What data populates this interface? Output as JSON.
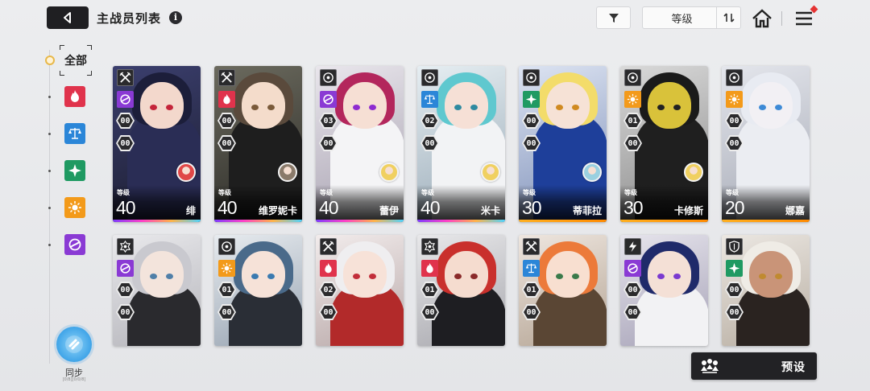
{
  "header": {
    "title": "主战员列表",
    "info_glyph": "i",
    "sort_label": "等级"
  },
  "sidebar": {
    "all_label": "全部",
    "elements": [
      {
        "name": "fire",
        "color": "#e0334c"
      },
      {
        "name": "order",
        "color": "#2b86d8"
      },
      {
        "name": "wind",
        "color": "#1f9a62"
      },
      {
        "name": "light",
        "color": "#f39a1a"
      },
      {
        "name": "void",
        "color": "#8a3ad4"
      }
    ],
    "sync_label": "同步",
    "sync_sub": "[0/8][0/0/8]"
  },
  "level_tag": "等级",
  "cards": [
    {
      "row": 1,
      "class": "sword",
      "element": "void",
      "num1": "00",
      "num2": "00",
      "level": "40",
      "name": "绯",
      "rarity": "ssr",
      "bg": [
        "#3b3f6e",
        "#1b1c2e"
      ],
      "hair": "#1c1e3a",
      "skin": "#f3d8cc",
      "body": "#2a2d55",
      "eye": "#c4243a",
      "support": "#e04848"
    },
    {
      "row": 1,
      "class": "sword",
      "element": "fire",
      "num1": "00",
      "num2": "00",
      "level": "40",
      "name": "维罗妮卡",
      "rarity": "ssr",
      "bg": [
        "#6b6a5e",
        "#2b2a26"
      ],
      "hair": "#5a4a3c",
      "skin": "#f4dccb",
      "body": "#1e1e1e",
      "eye": "#7a5a3a",
      "support": "#8a7a6a"
    },
    {
      "row": 1,
      "class": "target",
      "element": "void",
      "num1": "03",
      "num2": "00",
      "level": "40",
      "name": "蕾伊",
      "rarity": "ssr",
      "bg": [
        "#e9e6ec",
        "#a7a1b0"
      ],
      "hair": "#b3265c",
      "skin": "#f6dfd4",
      "body": "#f4f4f6",
      "eye": "#8e2bd0",
      "support": "#f0d060"
    },
    {
      "row": 1,
      "class": "target",
      "element": "order",
      "num1": "02",
      "num2": "00",
      "level": "40",
      "name": "米卡",
      "rarity": "ssr",
      "bg": [
        "#e6eef2",
        "#98a9b6"
      ],
      "hair": "#5fc8cf",
      "skin": "#f6e0d6",
      "body": "#f2f3f5",
      "eye": "#2f8aa0",
      "support": "#f0d060"
    },
    {
      "row": 1,
      "class": "target",
      "element": "wind",
      "num1": "00",
      "num2": "00",
      "level": "30",
      "name": "蒂菲拉",
      "rarity": "sr",
      "bg": [
        "#dde4f2",
        "#7d8fb8"
      ],
      "hair": "#f3dc6a",
      "skin": "#f6e2d6",
      "body": "#1e3f9a",
      "eye": "#d08a20",
      "support": "#9ad0e0"
    },
    {
      "row": 1,
      "class": "target",
      "element": "light",
      "num1": "01",
      "num2": "00",
      "level": "30",
      "name": "卡修斯",
      "rarity": "sr",
      "bg": [
        "#d9d9d9",
        "#8a8a8a"
      ],
      "hair": "#1a1a1a",
      "skin": "#d9c23a",
      "body": "#1f1f1f",
      "eye": "#222222",
      "support": "#f0d060"
    },
    {
      "row": 1,
      "class": "target",
      "element": "light",
      "num1": "00",
      "num2": "00",
      "level": "20",
      "name": "娜嘉",
      "rarity": "sr",
      "bg": [
        "#e4e6ec",
        "#a5a9b5"
      ],
      "hair": "#e8ebf2",
      "skin": "#f2f0f4",
      "body": "#ebedf2",
      "eye": "#3d8ad6",
      "support": ""
    },
    {
      "row": 2,
      "class": "gear",
      "element": "void",
      "num1": "00",
      "num2": "00",
      "level": "",
      "name": "",
      "rarity": "",
      "bg": [
        "#e9e9ec",
        "#b4b4ba"
      ],
      "hair": "#c9c9cf",
      "skin": "#f3e4dc",
      "body": "#2a2a2e",
      "eye": "#4f7fa8",
      "support": ""
    },
    {
      "row": 2,
      "class": "target",
      "element": "light",
      "num1": "01",
      "num2": "00",
      "level": "",
      "name": "",
      "rarity": "",
      "bg": [
        "#e7ebef",
        "#98a4b2"
      ],
      "hair": "#4a6a8a",
      "skin": "#f6e2d8",
      "body": "#2a2e36",
      "eye": "#3a7ab0",
      "support": ""
    },
    {
      "row": 2,
      "class": "sword",
      "element": "fire",
      "num1": "02",
      "num2": "00",
      "level": "",
      "name": "",
      "rarity": "",
      "bg": [
        "#f2ecec",
        "#b9a9a9"
      ],
      "hair": "#efeef0",
      "skin": "#f7e2d8",
      "body": "#b22a2a",
      "eye": "#c22e3a",
      "support": ""
    },
    {
      "row": 2,
      "class": "gear",
      "element": "fire",
      "num1": "01",
      "num2": "00",
      "level": "",
      "name": "",
      "rarity": "",
      "bg": [
        "#e8e8ea",
        "#a8a8ae"
      ],
      "hair": "#c9302c",
      "skin": "#f5dccf",
      "body": "#1e1e22",
      "eye": "#8a2a2a",
      "support": ""
    },
    {
      "row": 2,
      "class": "sword",
      "element": "order",
      "num1": "01",
      "num2": "00",
      "level": "",
      "name": "",
      "rarity": "",
      "bg": [
        "#eee6df",
        "#b5a595"
      ],
      "hair": "#ec7a3a",
      "skin": "#f8dfd0",
      "body": "#5a4634",
      "eye": "#3a7a4a",
      "support": ""
    },
    {
      "row": 2,
      "class": "bolt",
      "element": "void",
      "num1": "00",
      "num2": "00",
      "level": "",
      "name": "",
      "rarity": "",
      "bg": [
        "#e6e4ec",
        "#a7a3b8"
      ],
      "hair": "#1f2a6a",
      "skin": "#f4e0d6",
      "body": "#f2f2f4",
      "eye": "#7a3ad0",
      "support": ""
    },
    {
      "row": 2,
      "class": "shield",
      "element": "wind",
      "num1": "00",
      "num2": "00",
      "level": "",
      "name": "",
      "rarity": "",
      "bg": [
        "#ebe7e2",
        "#b8aea2"
      ],
      "hair": "#efece6",
      "skin": "#c99478",
      "body": "#2a2320",
      "eye": "#c08a30",
      "support": ""
    }
  ],
  "preset_label": "预设"
}
